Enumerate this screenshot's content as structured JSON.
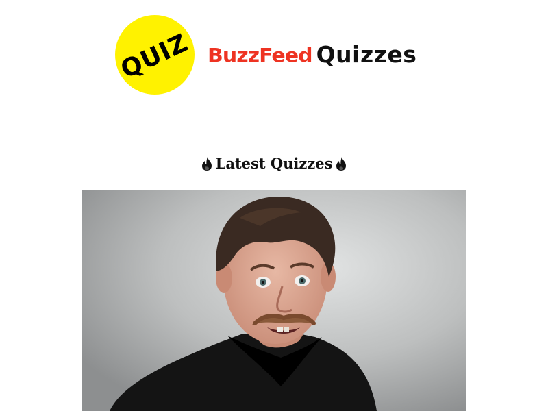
{
  "header": {
    "badge_text": "QUIZ",
    "brand_name": "BuzzFeed",
    "product_name": "Quizzes",
    "colors": {
      "badge": "#fff200",
      "brand": "#ee3322",
      "text": "#111111"
    }
  },
  "section": {
    "title": "Latest Quizzes",
    "icon": "fire-icon"
  },
  "featured_quiz": {
    "image": "person-portrait-photo"
  }
}
